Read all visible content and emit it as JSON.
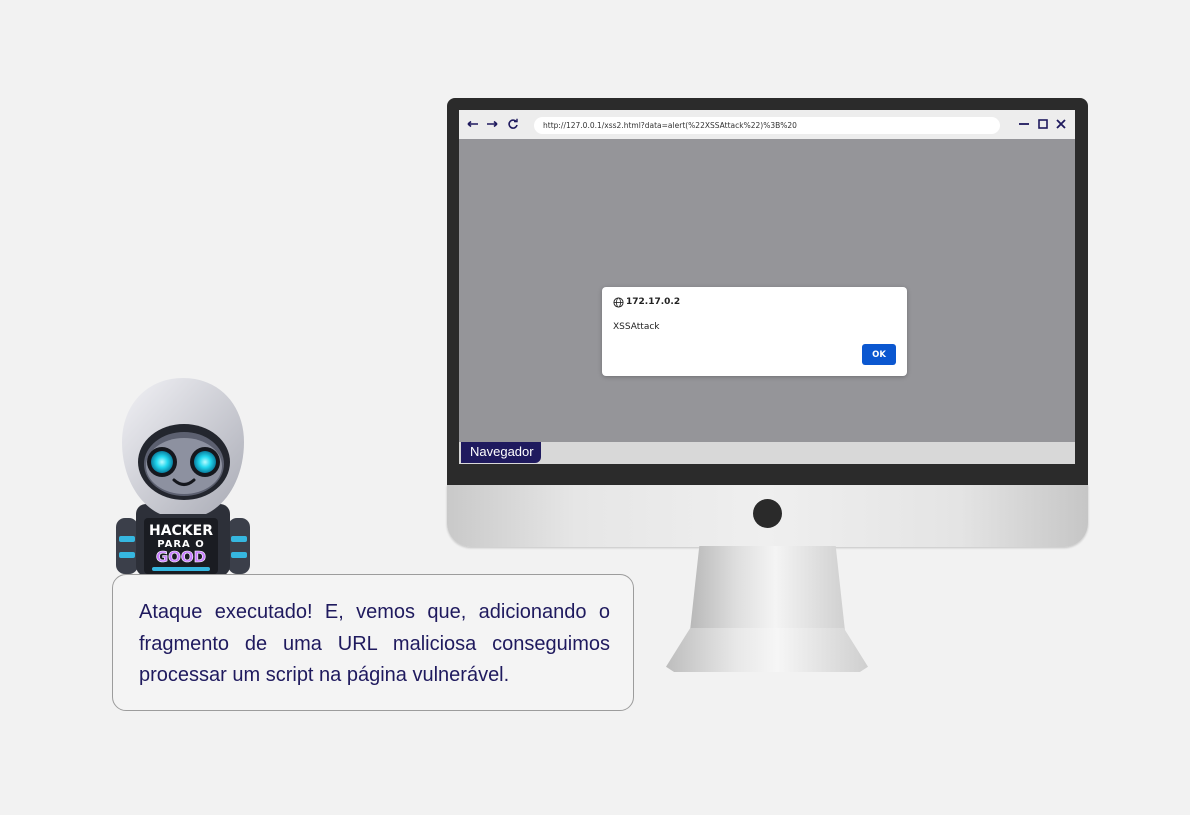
{
  "browser": {
    "url": "http://127.0.0.1/xss2.html?data=alert(%22XSSAttack%22)%3B%20",
    "icons": {
      "back": "arrow-left-icon",
      "forward": "arrow-right-icon",
      "reload": "reload-icon",
      "minimize": "minimize-icon",
      "maximize": "maximize-icon",
      "close": "close-icon"
    },
    "tab_label": "Navegador"
  },
  "alert_dialog": {
    "origin": "172.17.0.2",
    "message": "XSSAttack",
    "ok_label": "OK",
    "icon": "globe-icon"
  },
  "mascot": {
    "badge_line1": "HACKER",
    "badge_line2": "PARA O",
    "badge_line3": "GOOD"
  },
  "caption": {
    "text": "Ataque executado! E, vemos que, adicionando o fragmento de uma URL maliciosa conseguimos processar um script na página vulnerável."
  },
  "colors": {
    "brand": "#1f1a5e",
    "ok_button": "#0b57d0",
    "page_background": "#959599"
  }
}
